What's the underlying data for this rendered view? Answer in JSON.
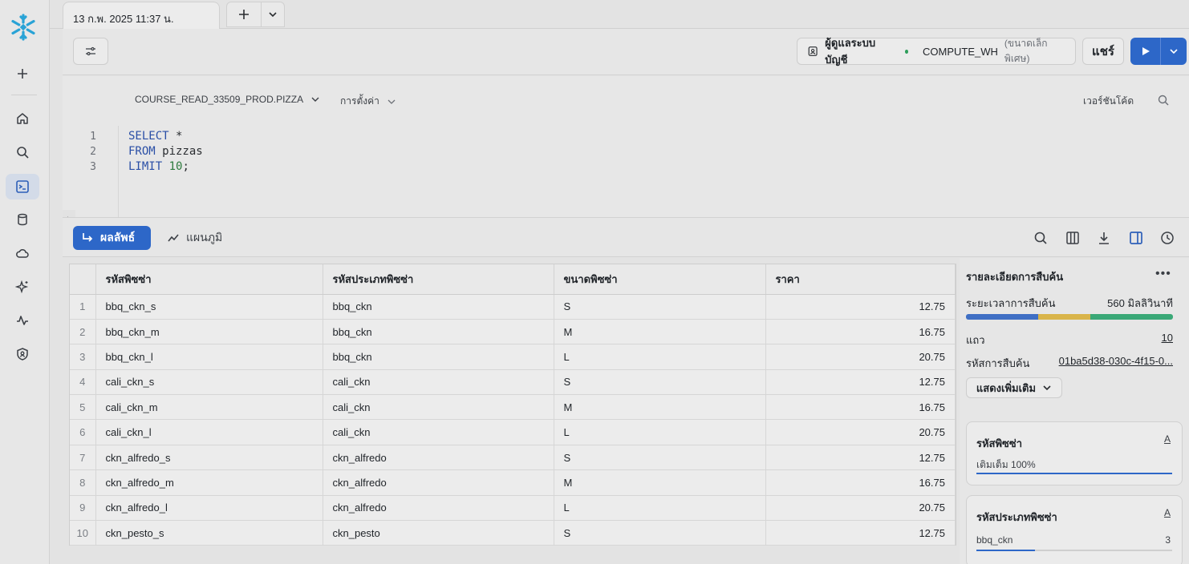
{
  "tab": {
    "title": "13 ก.พ. 2025 11:37 น."
  },
  "toolbar": {
    "role": "ผู้ดูแลระบบบัญชี",
    "warehouse": "COMPUTE_WH",
    "warehouse_size": "(ขนาดเล็กพิเศษ)",
    "share_label": "แชร์"
  },
  "editor": {
    "database": "COURSE_READ_33509_PROD.PIZZA",
    "settings": "การตั้งค่า",
    "version": "เวอร์ชันโค้ด",
    "line_numbers": [
      "1",
      "2",
      "3"
    ],
    "code": {
      "l1_kw": "SELECT",
      "l1_rest": " *",
      "l2_kw": "FROM",
      "l2_rest": " pizzas",
      "l3_kw": "LIMIT",
      "l3_num": " 10",
      "l3_rest": ";"
    }
  },
  "results": {
    "tab_results": "ผลลัพธ์",
    "tab_chart": "แผนภูมิ",
    "columns": [
      "รหัสพิซซ่า",
      "รหัสประเภทพิซซ่า",
      "ขนาดพิซซ่า",
      "ราคา"
    ],
    "rows": [
      [
        "1",
        "bbq_ckn_s",
        "bbq_ckn",
        "S",
        "12.75"
      ],
      [
        "2",
        "bbq_ckn_m",
        "bbq_ckn",
        "M",
        "16.75"
      ],
      [
        "3",
        "bbq_ckn_l",
        "bbq_ckn",
        "L",
        "20.75"
      ],
      [
        "4",
        "cali_ckn_s",
        "cali_ckn",
        "S",
        "12.75"
      ],
      [
        "5",
        "cali_ckn_m",
        "cali_ckn",
        "M",
        "16.75"
      ],
      [
        "6",
        "cali_ckn_l",
        "cali_ckn",
        "L",
        "20.75"
      ],
      [
        "7",
        "ckn_alfredo_s",
        "ckn_alfredo",
        "S",
        "12.75"
      ],
      [
        "8",
        "ckn_alfredo_m",
        "ckn_alfredo",
        "M",
        "16.75"
      ],
      [
        "9",
        "ckn_alfredo_l",
        "ckn_alfredo",
        "L",
        "20.75"
      ],
      [
        "10",
        "ckn_pesto_s",
        "ckn_pesto",
        "S",
        "12.75"
      ]
    ]
  },
  "details": {
    "title": "รายละเอียดการสืบค้น",
    "duration_label": "ระยะเวลาการสืบค้น",
    "duration_value": "560 มิลลิวินาที",
    "duration_segments": [
      {
        "fraction": 0.35,
        "color": "#3f6fc4"
      },
      {
        "fraction": 0.25,
        "color": "#d9b44a"
      },
      {
        "fraction": 0.4,
        "color": "#3aa877"
      }
    ],
    "rows_label": "แถว",
    "rows_value": "10",
    "query_id_label": "รหัสการสืบค้น",
    "query_id_value": "01ba5d38-030c-4f15-0...",
    "show_more": "แสดงเพิ่มเติม",
    "col1": {
      "name": "รหัสพิซซ่า",
      "type": "A",
      "stat": "เติมเต็ม 100%",
      "fill": 1.0
    },
    "col2": {
      "name": "รหัสประเภทพิซซ่า",
      "type": "A",
      "top_value": "bbq_ckn",
      "top_count": "3",
      "fill": 0.3
    }
  },
  "colors": {
    "accent": "#2d67c8",
    "success": "#2e9e5b"
  }
}
